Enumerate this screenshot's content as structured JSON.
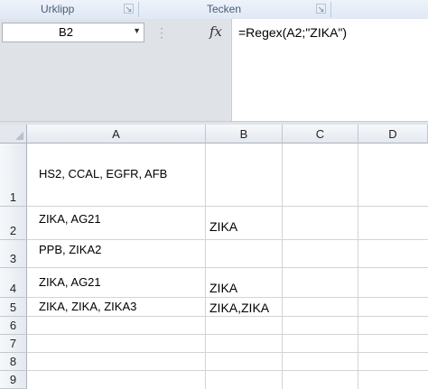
{
  "ribbon": {
    "groups": [
      {
        "label": "Urklipp"
      },
      {
        "label": "Tecken"
      }
    ],
    "launcher_glyph": "↘"
  },
  "formula_bar": {
    "name_box": "B2",
    "fx_label": "fx",
    "formula": "=Regex(A2;\"ZIKA\")"
  },
  "sheet": {
    "columns": [
      "A",
      "B",
      "C",
      "D"
    ],
    "rows": [
      "1",
      "2",
      "3",
      "4",
      "5",
      "6",
      "7",
      "8",
      "9"
    ],
    "cells": {
      "A1": "HS2, CCAL, EGFR, AFB",
      "A2": "ZIKA, AG21",
      "B2": "ZIKA",
      "A3": "PPB, ZIKA2",
      "A4": "ZIKA, AG21",
      "B4": "ZIKA",
      "A5": "ZIKA, ZIKA, ZIKA3",
      "B5": "ZIKA,ZIKA"
    }
  },
  "colors": {
    "ribbon_bg": "#dfe8f5",
    "header_bg": "#e4e9ef",
    "gridline": "#d4d4d4"
  }
}
